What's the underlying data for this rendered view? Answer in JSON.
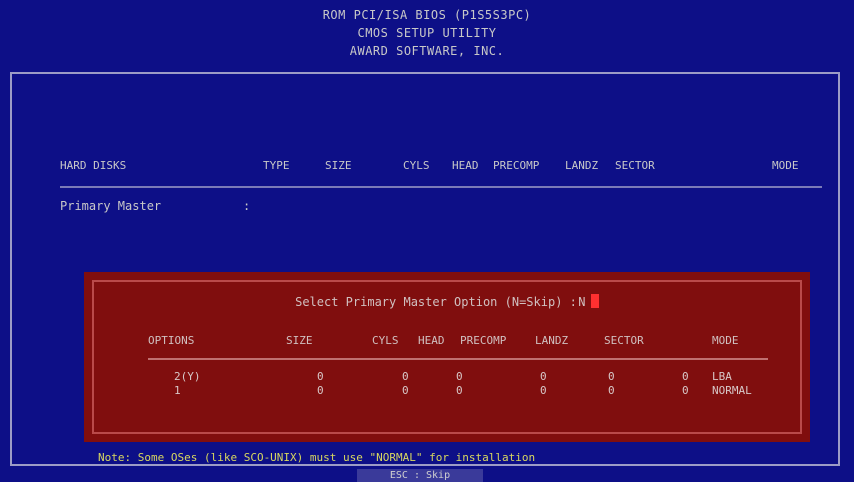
{
  "header": {
    "line1": "ROM PCI/ISA BIOS (P1S5S3PC)",
    "line2": "CMOS SETUP UTILITY",
    "line3": "AWARD SOFTWARE, INC."
  },
  "table": {
    "columns": [
      "HARD DISKS",
      "TYPE",
      "SIZE",
      "CYLS",
      "HEAD",
      "PRECOMP",
      "LANDZ",
      "SECTOR",
      "MODE"
    ],
    "rows": [
      {
        "label": "Primary Master",
        "sep": ":"
      }
    ]
  },
  "dialog": {
    "title": "Select Primary Master   Option (N=Skip) :",
    "value": "N",
    "columns": [
      "OPTIONS",
      "SIZE",
      "CYLS",
      "HEAD",
      "PRECOMP",
      "LANDZ",
      "SECTOR",
      "MODE"
    ],
    "options": [
      {
        "option": "2(Y)",
        "size": "0",
        "cyls": "0",
        "head": "0",
        "precomp": "0",
        "landz": "0",
        "sector": "0",
        "mode": "LBA"
      },
      {
        "option": "1",
        "size": "0",
        "cyls": "0",
        "head": "0",
        "precomp": "0",
        "landz": "0",
        "sector": "0",
        "mode": "NORMAL"
      }
    ]
  },
  "footer": {
    "note": "Note: Some OSes (like SCO-UNIX) must use \"NORMAL\" for installation",
    "esc": "ESC : Skip"
  },
  "colors": {
    "background": "#0d0f87",
    "dialog": "#800e0e",
    "note": "#d8d860",
    "cursor": "#ff3030"
  }
}
